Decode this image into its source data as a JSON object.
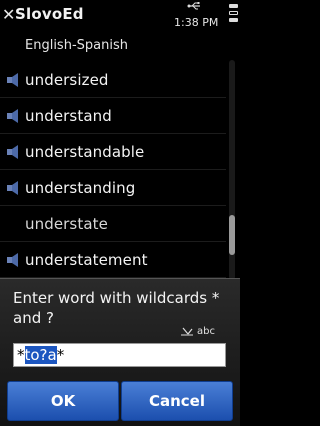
{
  "statusbar": {
    "app_title": "SlovoEd",
    "clock": "1:38 PM",
    "close_glyph": "✕",
    "icons": [
      "close-icon",
      "usb-icon",
      "options-menu-icon"
    ]
  },
  "dictionary": {
    "name": "English-Spanish"
  },
  "word_list": {
    "items": [
      {
        "word": "undersized",
        "has_audio": true
      },
      {
        "word": "understand",
        "has_audio": true
      },
      {
        "word": "understandable",
        "has_audio": true
      },
      {
        "word": "understanding",
        "has_audio": true
      },
      {
        "word": "understate",
        "has_audio": false
      },
      {
        "word": "understatement",
        "has_audio": true
      }
    ]
  },
  "dialog": {
    "prompt": "Enter word with wildcards * and ?",
    "input_mode": "abc",
    "input_prefix": "*",
    "input_selected": "to?a",
    "input_suffix": "*",
    "ok_label": "OK",
    "cancel_label": "Cancel"
  },
  "colors": {
    "button_blue": "#2b63c6",
    "selection_blue": "#1c56c0",
    "background": "#000000"
  }
}
